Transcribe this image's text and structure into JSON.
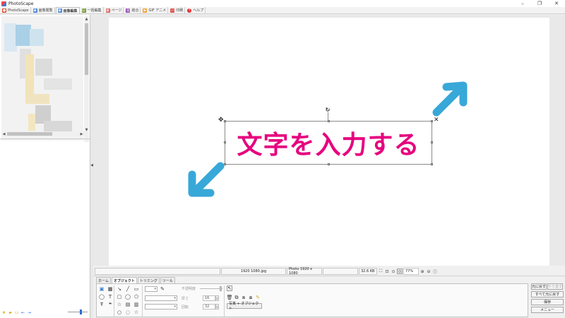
{
  "window": {
    "title": "PhotoScape",
    "minimize": "–",
    "maximize": "❐",
    "close": "✕"
  },
  "tabs": [
    {
      "label": "PhotoScape",
      "icon": "photoscape-icon",
      "color": "#e04a2a"
    },
    {
      "label": "画像閲覧",
      "icon": "viewer-icon",
      "color": "#3a7bd5"
    },
    {
      "label": "画像編集",
      "icon": "editor-icon",
      "color": "#3a7bd5",
      "active": true
    },
    {
      "label": "一括編集",
      "icon": "batch-icon",
      "color": "#6b8e23"
    },
    {
      "label": "ページ",
      "icon": "page-icon",
      "color": "#d9534f"
    },
    {
      "label": "結合",
      "icon": "combine-icon",
      "color": "#8e44ad"
    },
    {
      "label": "GIF アニメ",
      "icon": "gif-icon",
      "color": "#f0a030"
    },
    {
      "label": "印刷",
      "icon": "print-icon",
      "color": "#d9534f"
    },
    {
      "label": "ヘルプ",
      "icon": "help-icon",
      "color": "#e03030"
    }
  ],
  "canvas": {
    "text": "文字を入力する",
    "text_color": "#e6007e",
    "arrow_color": "#38a8d8"
  },
  "status": {
    "filename": "1920 1080.jpg",
    "photo_size": "Photo 1920 x 1080",
    "file_size": "32.6 KB",
    "zoom": "77%"
  },
  "bottom_tabs": [
    {
      "label": "ホーム"
    },
    {
      "label": "オブジェクト",
      "active": true
    },
    {
      "label": "トリミング"
    },
    {
      "label": "ツール"
    }
  ],
  "properties": {
    "opacity_label": "不透明度",
    "thickness_label": "厚さ",
    "thickness_value": "16",
    "rounding_label": "回転",
    "rounding_value": "32",
    "photo_object_button": "写真 + オブジェクト"
  },
  "right_buttons": {
    "undo": "元に戻す",
    "redo": "やり直す",
    "undo_all": "すべて元に戻す",
    "save": "保存",
    "menu": "メニュー"
  }
}
